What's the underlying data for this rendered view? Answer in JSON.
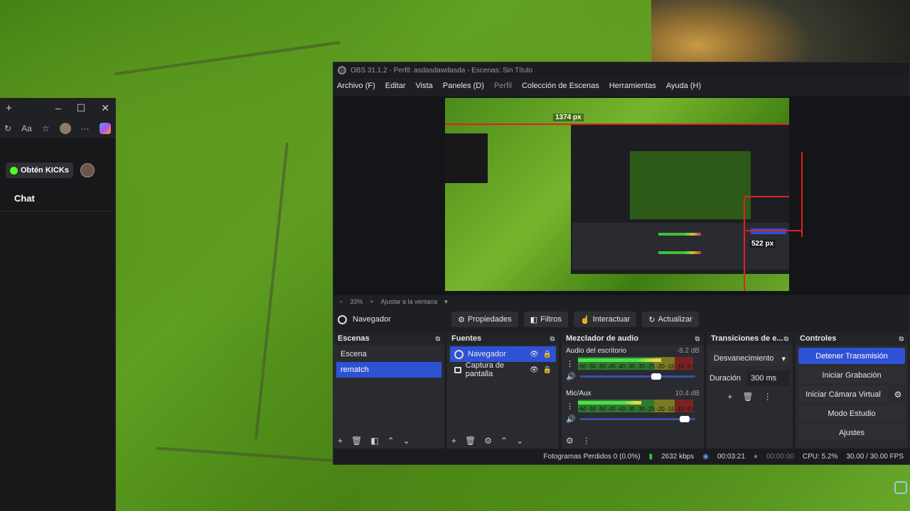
{
  "browser": {
    "tab_new": "+",
    "window_controls": [
      "–",
      "☐",
      "✕"
    ],
    "kick_button": "Obtén KICKs",
    "chat_title": "Chat"
  },
  "obs": {
    "title": "OBS 31.1.2 - Perfil: asdasdawdasda - Escenas: Sin Título",
    "menu": [
      "Archivo (F)",
      "Editar",
      "Vista",
      "Paneles (D)",
      "Perfil",
      "Colección de Escenas",
      "Herramientas",
      "Ayuda (H)"
    ],
    "preview": {
      "width_label": "1374 px",
      "height_label": "522 px"
    },
    "zoom": {
      "minus": "−",
      "value": "33%",
      "plus": "+",
      "fit": "Ajustar a la ventana"
    },
    "source_toolbar": {
      "source_name": "Navegador",
      "properties": "Propiedades",
      "filters": "Filtros",
      "interact": "Interactuar",
      "refresh": "Actualizar"
    },
    "scenes": {
      "title": "Escenas",
      "items": [
        "Escena",
        "rematch"
      ],
      "selected": "rematch"
    },
    "sources": {
      "title": "Fuentes",
      "items": [
        "Navegador",
        "Captura de pantalla"
      ]
    },
    "mixer": {
      "title": "Mezclador de audio",
      "channels": [
        {
          "name": "Audio del escritorio",
          "db": "-8.2 dB",
          "level": 0.72,
          "volume": 0.68
        },
        {
          "name": "Mic/Aux",
          "db": "10.4 dB",
          "level": 0.55,
          "volume": 0.95
        }
      ],
      "scale": "-60 -55 -50 -45 -40 -35 -30 -25 -20 -15 -10 -5 0"
    },
    "transitions": {
      "title": "Transiciones de e...",
      "selected": "Desvanecimiento",
      "duration_label": "Duración",
      "duration_value": "300 ms"
    },
    "controls": {
      "title": "Controles",
      "stop_stream": "Detener Transmisión",
      "start_recording": "Iniciar Grabación",
      "start_virtual_cam": "Iniciar Cámara Virtual",
      "studio_mode": "Modo Estudio",
      "settings": "Ajustes"
    },
    "status": {
      "dropped_frames": "Fotogramas Perdidos 0 (0.0%)",
      "bitrate": "2632 kbps",
      "stream_time": "00:03:21",
      "rec_time": "00:00:00",
      "cpu": "CPU: 5.2%",
      "fps": "30.00 / 30.00 FPS"
    }
  },
  "colors": {
    "accent": "#2f52d4",
    "panel": "#2a2b30",
    "window": "#1e1f22",
    "guide": "#e02020"
  }
}
